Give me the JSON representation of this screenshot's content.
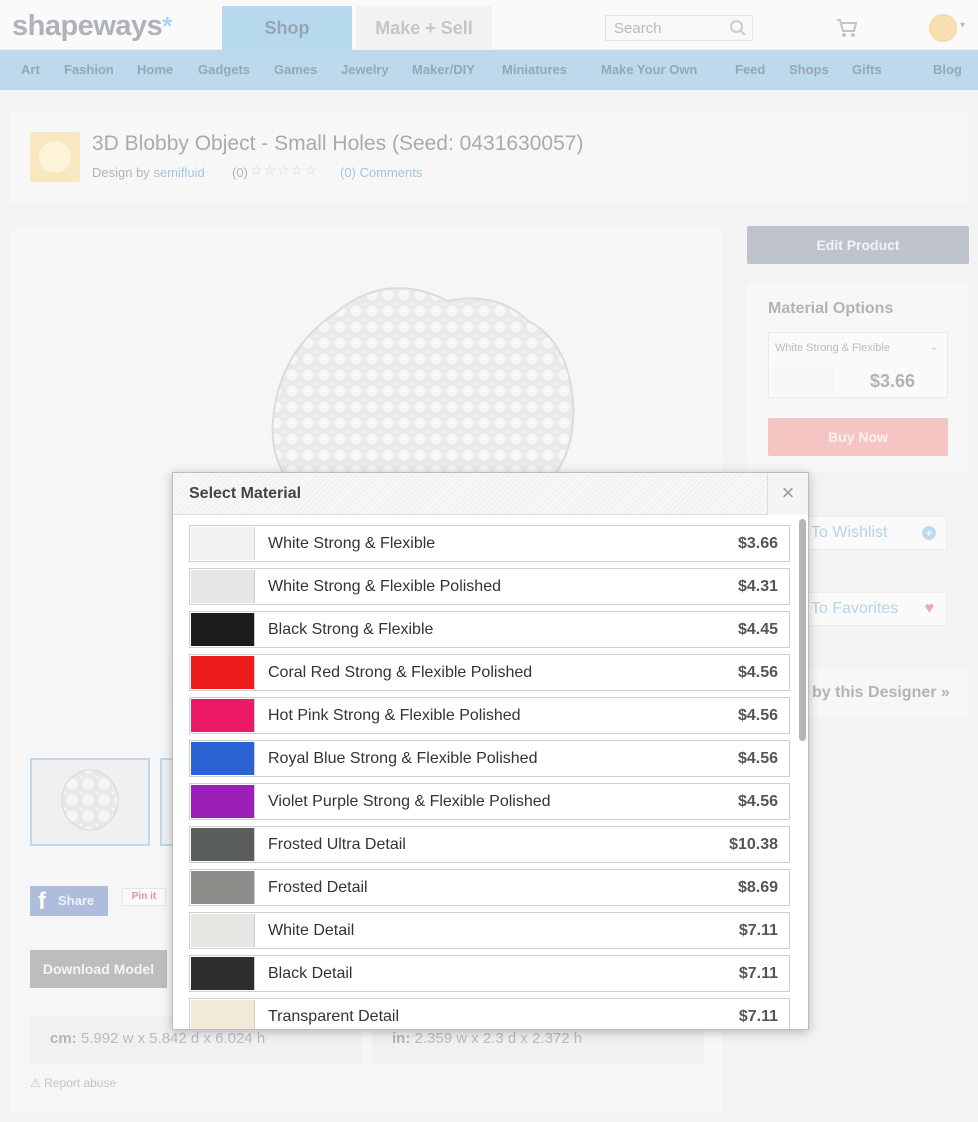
{
  "header": {
    "logo_text": "shapeways",
    "logo_star": "*",
    "tabs": [
      {
        "label": "Shop"
      },
      {
        "label": "Make + Sell"
      }
    ],
    "search_placeholder": "Search"
  },
  "nav": {
    "items": [
      "Art",
      "Fashion",
      "Home",
      "Gadgets",
      "Games",
      "Jewelry",
      "Maker/DIY",
      "Miniatures",
      "Make Your Own",
      "Feed",
      "Shops",
      "Gifts",
      "Blog"
    ]
  },
  "product": {
    "title": "3D Blobby Object - Small Holes (Seed: 0431630057)",
    "design_by_label": "Design by",
    "designer": "semifluid",
    "rating_count": "(0)",
    "stars": "☆☆☆☆☆",
    "comments": "(0) Comments"
  },
  "viewer": {
    "share_label": "Share",
    "pinit_label": "Pin it",
    "download_label": "Download Model",
    "dims_cm_label": "cm:",
    "dims_cm_value": "5.992 w x 5.842 d x 6.024 h",
    "dims_in_label": "in:",
    "dims_in_value": "2.359 w x 2.3 d x 2.372 h",
    "report_label": "Report abuse"
  },
  "sidebar": {
    "edit_label": "Edit Product",
    "options_title": "Material Options",
    "selected_material": "White Strong & Flexible",
    "selected_price": "$3.66",
    "buy_label": "Buy Now",
    "wishlist_label": "To Wishlist",
    "favorites_label": "To Favorites",
    "by_designer_label": "by this Designer »"
  },
  "modal": {
    "title": "Select Material",
    "close_glyph": "×",
    "materials": [
      {
        "name": "White Strong & Flexible",
        "price": "$3.66",
        "swatch": "#f1f1ef"
      },
      {
        "name": "White Strong & Flexible Polished",
        "price": "$4.31",
        "swatch": "#e6e6e6"
      },
      {
        "name": "Black Strong & Flexible",
        "price": "$4.45",
        "swatch": "#1c1c1c"
      },
      {
        "name": "Coral Red Strong & Flexible Polished",
        "price": "$4.56",
        "swatch": "#ec1c1c"
      },
      {
        "name": "Hot Pink Strong & Flexible Polished",
        "price": "$4.56",
        "swatch": "#ec1a66"
      },
      {
        "name": "Royal Blue Strong & Flexible Polished",
        "price": "$4.56",
        "swatch": "#2c63d4"
      },
      {
        "name": "Violet Purple Strong & Flexible Polished",
        "price": "$4.56",
        "swatch": "#9b1fb8"
      },
      {
        "name": "Frosted Ultra Detail",
        "price": "$10.38",
        "swatch": "#5a5e5a"
      },
      {
        "name": "Frosted Detail",
        "price": "$8.69",
        "swatch": "#8c8c88"
      },
      {
        "name": "White Detail",
        "price": "$7.11",
        "swatch": "#e6e6e2"
      },
      {
        "name": "Black Detail",
        "price": "$7.11",
        "swatch": "#2e2e2e"
      },
      {
        "name": "Transparent Detail",
        "price": "$7.11",
        "swatch": "#f1ead8"
      }
    ]
  }
}
